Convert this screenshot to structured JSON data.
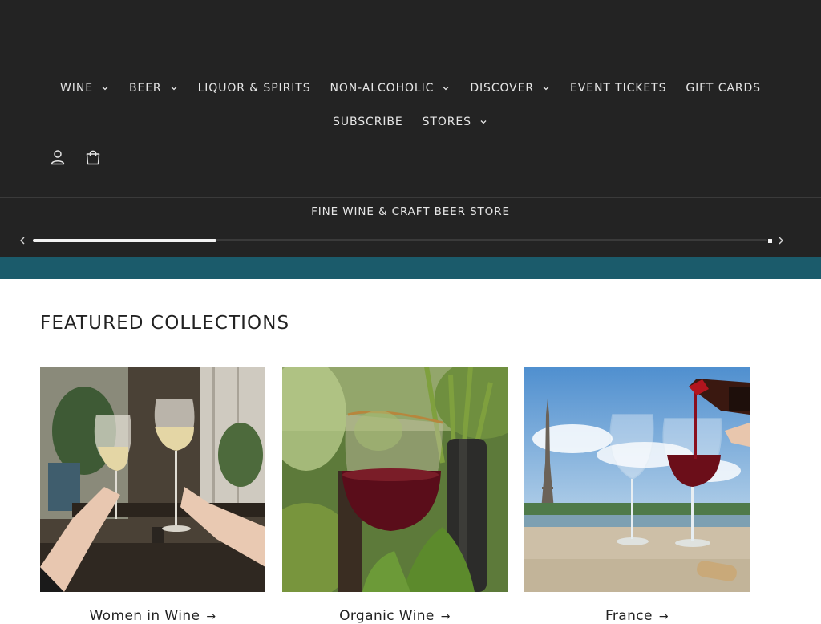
{
  "nav": {
    "row1": [
      {
        "label": "WINE",
        "has_dropdown": true
      },
      {
        "label": "BEER",
        "has_dropdown": true
      },
      {
        "label": "LIQUOR & SPIRITS",
        "has_dropdown": false
      },
      {
        "label": "NON-ALCOHOLIC",
        "has_dropdown": true
      },
      {
        "label": "DISCOVER",
        "has_dropdown": true
      },
      {
        "label": "EVENT TICKETS",
        "has_dropdown": false
      },
      {
        "label": "GIFT CARDS",
        "has_dropdown": false
      }
    ],
    "row2": [
      {
        "label": "SUBSCRIBE",
        "has_dropdown": false
      },
      {
        "label": "STORES",
        "has_dropdown": true
      }
    ]
  },
  "header_icons": [
    "account-icon",
    "cart-icon"
  ],
  "announcement": {
    "text": "FINE WINE & CRAFT BEER STORE",
    "slider_progress": 0.25
  },
  "featured": {
    "title": "FEATURED COLLECTIONS",
    "cards": [
      {
        "title": "Women in Wine",
        "arrow": "→"
      },
      {
        "title": "Organic Wine",
        "arrow": "→"
      },
      {
        "title": "France",
        "arrow": "→"
      }
    ]
  },
  "colors": {
    "header_bg": "#232323",
    "accent_band": "#1b5b6b",
    "nav_text": "#e6e6e6"
  }
}
